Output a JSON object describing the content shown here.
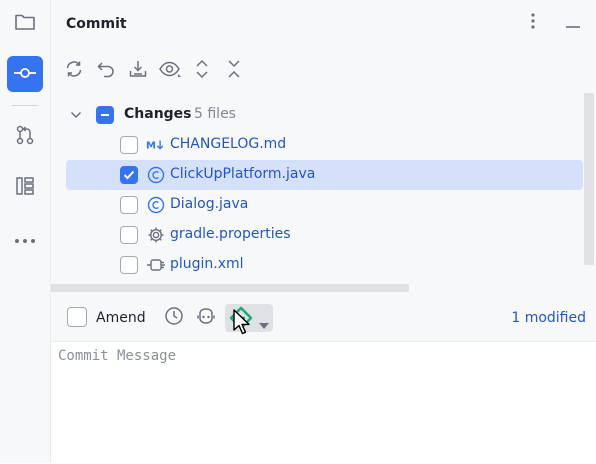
{
  "panel": {
    "title": "Commit"
  },
  "strip": {
    "items": [
      {
        "icon": "folder-icon",
        "active": false
      },
      {
        "icon": "commit-icon",
        "active": true
      },
      {
        "icon": "pull-requests-icon",
        "active": false
      },
      {
        "icon": "structure-icon",
        "active": false
      },
      {
        "icon": "more-icon",
        "active": false
      }
    ]
  },
  "toolbar": {
    "icons": [
      "refresh-icon",
      "rollback-icon",
      "shelve-icon",
      "preview-icon",
      "expand-all-icon",
      "collapse-all-icon"
    ]
  },
  "changes": {
    "group_label": "Changes",
    "group_count": "5 files",
    "files": [
      {
        "name": "CHANGELOG.md",
        "icon": "markdown-icon",
        "checked": false,
        "selected": false
      },
      {
        "name": "ClickUpPlatform.java",
        "icon": "java-class-icon",
        "checked": true,
        "selected": true
      },
      {
        "name": "Dialog.java",
        "icon": "java-class-icon",
        "checked": false,
        "selected": false
      },
      {
        "name": "gradle.properties",
        "icon": "properties-icon",
        "checked": false,
        "selected": false
      },
      {
        "name": "plugin.xml",
        "icon": "plugin-xml-icon",
        "checked": false,
        "selected": false
      }
    ]
  },
  "amend": {
    "label": "Amend",
    "modified": "1 modified"
  },
  "message": {
    "placeholder": "Commit Message"
  },
  "colors": {
    "accent": "#3574f0",
    "link": "#2455c4",
    "selection": "#d5e1fb",
    "ai_green": "#21a97a"
  }
}
